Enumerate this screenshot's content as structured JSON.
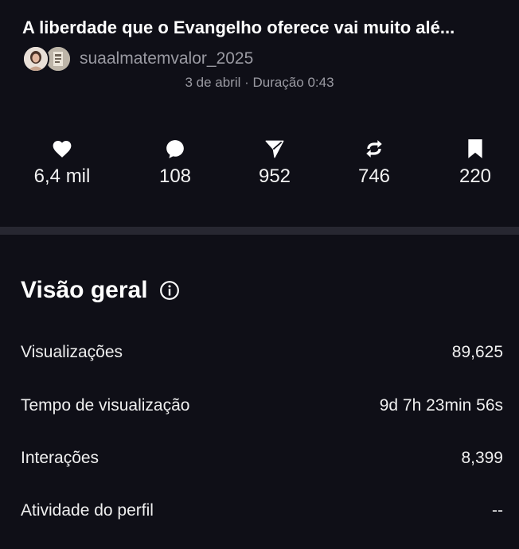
{
  "post": {
    "title": "A liberdade que o Evangelho oferece vai muito alé...",
    "author": "suaalmatemvalor_2025",
    "meta": "3 de abril · Duração 0:43"
  },
  "stats": [
    {
      "icon": "heart-icon",
      "value": "6,4 mil"
    },
    {
      "icon": "comment-icon",
      "value": "108"
    },
    {
      "icon": "send-icon",
      "value": "952"
    },
    {
      "icon": "repost-icon",
      "value": "746"
    },
    {
      "icon": "bookmark-icon",
      "value": "220"
    }
  ],
  "overview": {
    "title": "Visão geral",
    "rows": [
      {
        "label": "Visualizações",
        "value": "89,625"
      },
      {
        "label": "Tempo de visualização",
        "value": "9d 7h 23min 56s"
      },
      {
        "label": "Interações",
        "value": "8,399"
      },
      {
        "label": "Atividade do perfil",
        "value": "--"
      }
    ]
  },
  "colors": {
    "background": "#0f0f17",
    "text": "#f2f2f2",
    "muted": "#9a9aa2",
    "divider": "#272731"
  }
}
